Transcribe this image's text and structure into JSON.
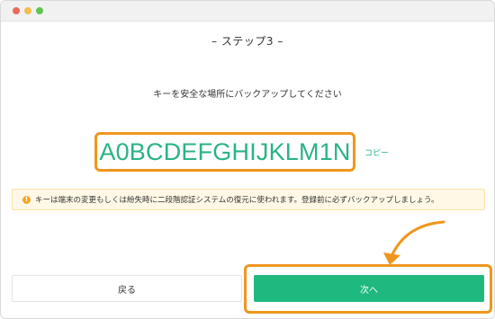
{
  "step": {
    "title": "– ステップ3 –"
  },
  "instruction": "キーを安全な場所にバックアップしてください",
  "key": {
    "value": "A0BCDEFGHIJKLM1N",
    "copy_label": "コピー"
  },
  "notice": {
    "icon": "warning-icon",
    "text": "キーは端末の変更もしくは紛失時に二段階認証システムの復元に使われます。登録前に必ずバックアップしましょう。"
  },
  "buttons": {
    "back_label": "戻る",
    "next_label": "次へ"
  },
  "colors": {
    "accent": "#1fb87f",
    "highlight": "#f0961e",
    "notice_bg": "#fff8e6"
  }
}
